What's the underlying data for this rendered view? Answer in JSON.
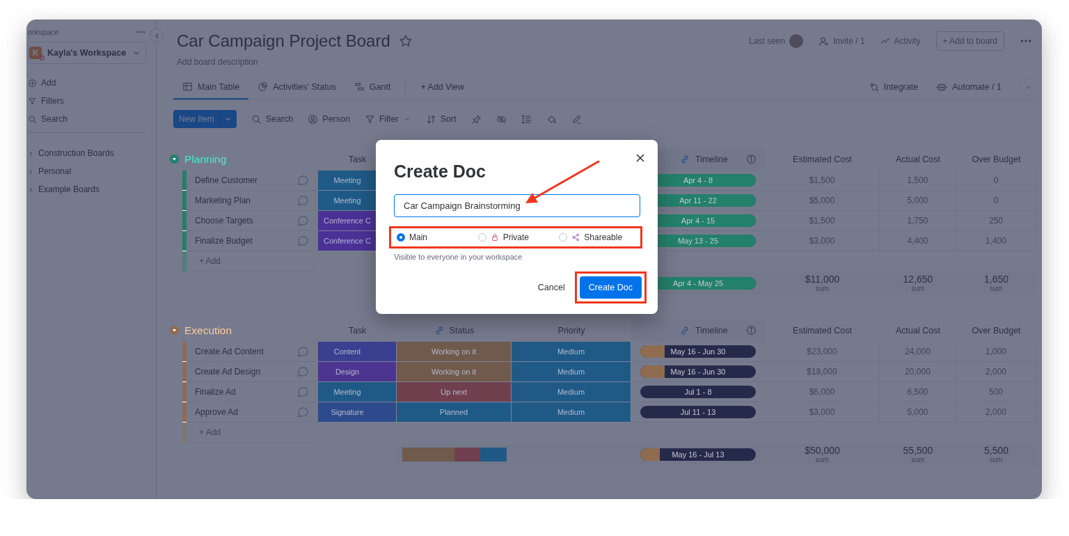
{
  "sidebar": {
    "heading": "orkspace",
    "workspace": {
      "avatar_letter": "K",
      "name": "Kayla's Workspace"
    },
    "actions": [
      {
        "kind": "add",
        "label": "Add"
      },
      {
        "kind": "filter",
        "label": "Filters"
      },
      {
        "kind": "search",
        "label": "Search"
      }
    ],
    "boards": [
      "Construction Boards",
      "Personal",
      "Example Boards"
    ]
  },
  "board": {
    "title": "Car Campaign Project Board",
    "description": "Add board description",
    "last_seen": "Last seen",
    "invite": "Invite / 1",
    "activity": "Activity",
    "add_to_board": "+ Add to board"
  },
  "views": [
    {
      "kind": "table",
      "label": "Main Table",
      "selected": true
    },
    {
      "kind": "chart",
      "label": "Activities' Status",
      "selected": false
    },
    {
      "kind": "gantt",
      "label": "Gantt",
      "selected": false
    }
  ],
  "add_view": "+ Add View",
  "integrate": "Integrate",
  "automate": "Automate / 1",
  "toolbar": {
    "new_item": "New Item",
    "search": "Search",
    "person": "Person",
    "filter": "Filter",
    "sort": "Sort"
  },
  "groups": [
    {
      "name": "Planning",
      "color": "#23806a",
      "columns": {
        "task": "Task",
        "timeline": "Timeline",
        "estimated_cost": "Estimated Cost",
        "actual_cost": "Actual Cost",
        "over_budget": "Over Budget"
      },
      "items": [
        {
          "name": "Define Customer",
          "task": {
            "label": "Meeting",
            "color": "#1f5a87"
          },
          "timeline": {
            "label": "Apr 4 - 8",
            "level": 1
          },
          "estimated_cost": "$1,500",
          "actual_cost": "1,500",
          "over_budget": "0"
        },
        {
          "name": "Marketing Plan",
          "task": {
            "label": "Meeting",
            "color": "#1f5a87"
          },
          "timeline": {
            "label": "Apr 11 - 22",
            "level": 1
          },
          "estimated_cost": "$5,000",
          "actual_cost": "5,000",
          "over_budget": "0"
        },
        {
          "name": "Choose Targets",
          "task": {
            "label": "Conference C",
            "color": "#4a3196"
          },
          "timeline": {
            "label": "Apr 4 - 15",
            "level": 1
          },
          "estimated_cost": "$1,500",
          "actual_cost": "1,750",
          "over_budget": "250"
        },
        {
          "name": "Finalize Budget",
          "task": {
            "label": "Conference C",
            "color": "#4a3196"
          },
          "timeline": {
            "label": "May 13 - 25",
            "level": 1
          },
          "estimated_cost": "$3,000",
          "actual_cost": "4,400",
          "over_budget": "1,400"
        }
      ],
      "add_label": "+ Add",
      "summary": {
        "timeline": {
          "label": "Apr 4 - May 25",
          "level": 1
        },
        "estimated_cost": {
          "value": "$11,000",
          "label": "sum"
        },
        "actual_cost": {
          "value": "12,650",
          "label": "sum"
        },
        "over_budget": {
          "value": "1,650",
          "label": "sum"
        }
      }
    },
    {
      "name": "Execution",
      "color": "#8f6c50",
      "columns": {
        "task": "Task",
        "status": "Status",
        "priority": "Priority",
        "timeline": "Timeline",
        "estimated_cost": "Estimated Cost",
        "actual_cost": "Actual Cost",
        "over_budget": "Over Budget"
      },
      "items": [
        {
          "name": "Create Ad Content",
          "task": {
            "label": "Content",
            "color": "#3a3f90"
          },
          "status": {
            "label": "Working on it",
            "color": "#6f5a4c"
          },
          "priority": {
            "label": "Medium",
            "color": "#1f5a87"
          },
          "timeline": {
            "label": "May 16 - Jun 30",
            "level": 0.21
          },
          "estimated_cost": "$23,000",
          "actual_cost": "24,000",
          "over_budget": "1,000"
        },
        {
          "name": "Create Ad Design",
          "task": {
            "label": "Design",
            "color": "#4c3590"
          },
          "status": {
            "label": "Working on it",
            "color": "#6f5a4c"
          },
          "priority": {
            "label": "Medium",
            "color": "#1f5a87"
          },
          "timeline": {
            "label": "May 16 - Jun 30",
            "level": 0.21
          },
          "estimated_cost": "$18,000",
          "actual_cost": "20,000",
          "over_budget": "2,000"
        },
        {
          "name": "Finalize Ad",
          "task": {
            "label": "Meeting",
            "color": "#1f5a87"
          },
          "status": {
            "label": "Up next",
            "color": "#703f4e"
          },
          "priority": {
            "label": "Medium",
            "color": "#1f5a87"
          },
          "timeline": {
            "label": "Jul 1 - 8"
          },
          "estimated_cost": "$6,000",
          "actual_cost": "6,500",
          "over_budget": "500"
        },
        {
          "name": "Approve Ad",
          "task": {
            "label": "Signature",
            "color": "#2d4b8c"
          },
          "status": {
            "label": "Planned",
            "color": "#1f5a87"
          },
          "priority": {
            "label": "Medium",
            "color": "#1f5a87"
          },
          "timeline": {
            "label": "Jul 11 - 13"
          },
          "estimated_cost": "$3,000",
          "actual_cost": "5,000",
          "over_budget": "2,000"
        }
      ],
      "add_label": "+ Add",
      "summary": {
        "timeline": {
          "label": "May 16 - Jul 13",
          "level": 0.17
        },
        "estimated_cost": {
          "value": "$50,000",
          "label": "sum"
        },
        "actual_cost": {
          "value": "55,500",
          "label": "sum"
        },
        "over_budget": {
          "value": "5,500",
          "label": "sum"
        }
      }
    }
  ],
  "dialog": {
    "title": "Create Doc",
    "name_value": "Car Campaign Brainstorming",
    "visibility": [
      {
        "kind": "main",
        "label": "Main",
        "selected": true
      },
      {
        "kind": "private",
        "label": "Private",
        "selected": false
      },
      {
        "kind": "shareable",
        "label": "Shareable",
        "selected": false
      }
    ],
    "hint": "Visible to everyone in your workspace",
    "cancel": "Cancel",
    "confirm": "Create Doc"
  }
}
